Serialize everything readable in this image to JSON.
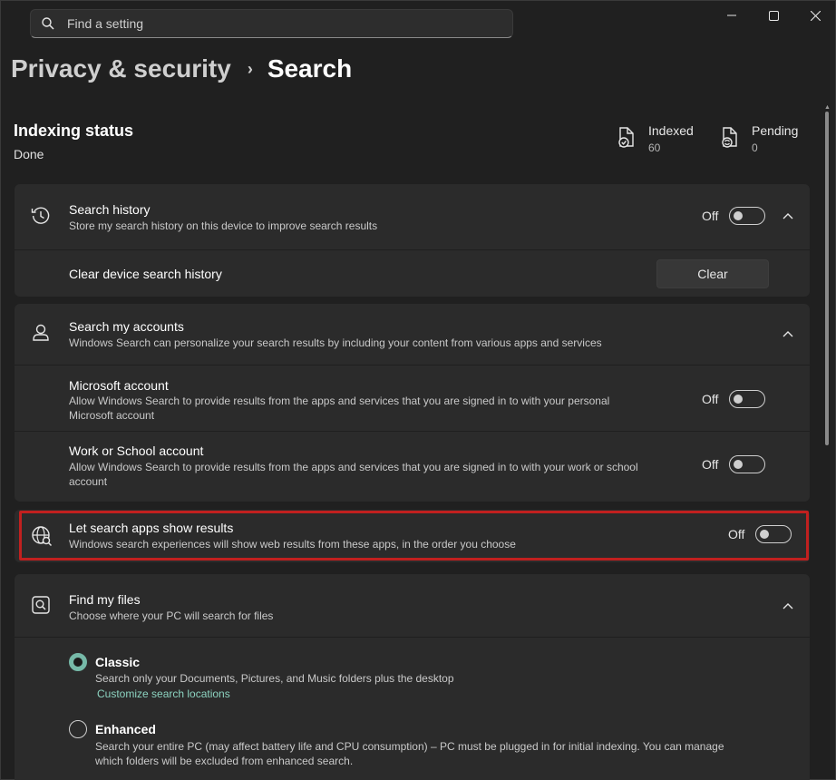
{
  "window": {
    "minimize_icon": "minimize-icon",
    "maximize_icon": "maximize-icon",
    "close_icon": "close-icon"
  },
  "search": {
    "placeholder": "Find a setting",
    "icon": "search-icon"
  },
  "breadcrumb": {
    "parent": "Privacy & security",
    "separator": "›",
    "current": "Search"
  },
  "indexing": {
    "title": "Indexing status",
    "status": "Done",
    "indexed_label": "Indexed",
    "indexed_value": "60",
    "pending_label": "Pending",
    "pending_value": "0"
  },
  "search_history": {
    "title": "Search history",
    "description": "Store my search history on this device to improve search results",
    "toggle_label": "Off",
    "clear_title": "Clear device search history",
    "clear_button": "Clear"
  },
  "accounts": {
    "title": "Search my accounts",
    "description": "Windows Search can personalize your search results by including your content from various apps and services",
    "microsoft": {
      "title": "Microsoft account",
      "description_line1": "Allow Windows Search to provide results from the apps and services that you are signed in to with your personal",
      "description_line2": "Microsoft account",
      "toggle_label": "Off"
    },
    "work": {
      "title": "Work or School account",
      "description_line1": "Allow Windows Search to provide results from the apps and services that you are signed in to with your work or school",
      "description_line2": "account",
      "toggle_label": "Off"
    }
  },
  "search_apps": {
    "title": "Let search apps show results",
    "description": "Windows search experiences will show web results from these apps, in the order you choose",
    "toggle_label": "Off"
  },
  "find_files": {
    "title": "Find my files",
    "description": "Choose where your PC will search for files",
    "classic": {
      "title": "Classic",
      "description": "Search only your Documents, Pictures, and Music folders plus the desktop",
      "link": "Customize search locations"
    },
    "enhanced": {
      "title": "Enhanced",
      "description_line1": "Search your entire PC (may affect battery life and CPU consumption) – PC must be plugged in for initial indexing. You can manage",
      "description_line2": "which folders will be excluded from enhanced search."
    }
  },
  "colors": {
    "accent": "#76b9a8",
    "link": "#8cd3c0",
    "highlight_border": "#c1201f",
    "background": "#202020",
    "card": "#2b2b2b"
  }
}
